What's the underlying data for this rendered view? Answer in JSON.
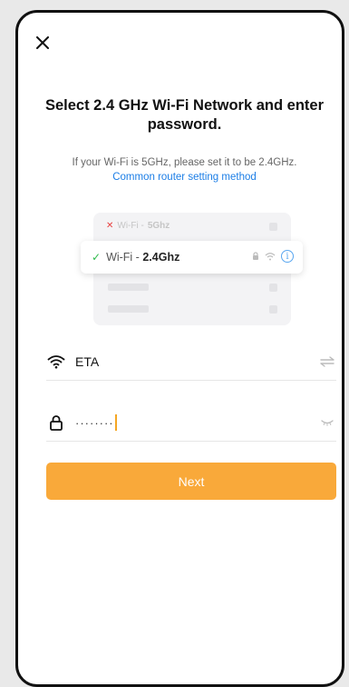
{
  "header": {
    "title": "Select 2.4 GHz Wi-Fi Network and enter password.",
    "subtitle": "If your Wi-Fi is 5GHz, please set it to be 2.4GHz.",
    "router_link": "Common router setting method"
  },
  "illustration": {
    "bad_network_prefix": "Wi-Fi - ",
    "bad_network_band": "5Ghz",
    "good_network_prefix": "Wi-Fi - ",
    "good_network_band": "2.4Ghz",
    "bad_icon": "x-icon",
    "good_icon": "check-icon",
    "info_glyph": "i"
  },
  "form": {
    "ssid_value": "ETA",
    "ssid_icon": "wifi-icon",
    "ssid_action_icon": "switch-network-icon",
    "password_value": "········",
    "password_icon": "lock-icon",
    "password_action_icon": "eye-closed-icon"
  },
  "actions": {
    "next_label": "Next"
  },
  "colors": {
    "accent": "#f9a93a",
    "link": "#1c7ee6",
    "success": "#2fba4c",
    "error": "#e84141"
  }
}
